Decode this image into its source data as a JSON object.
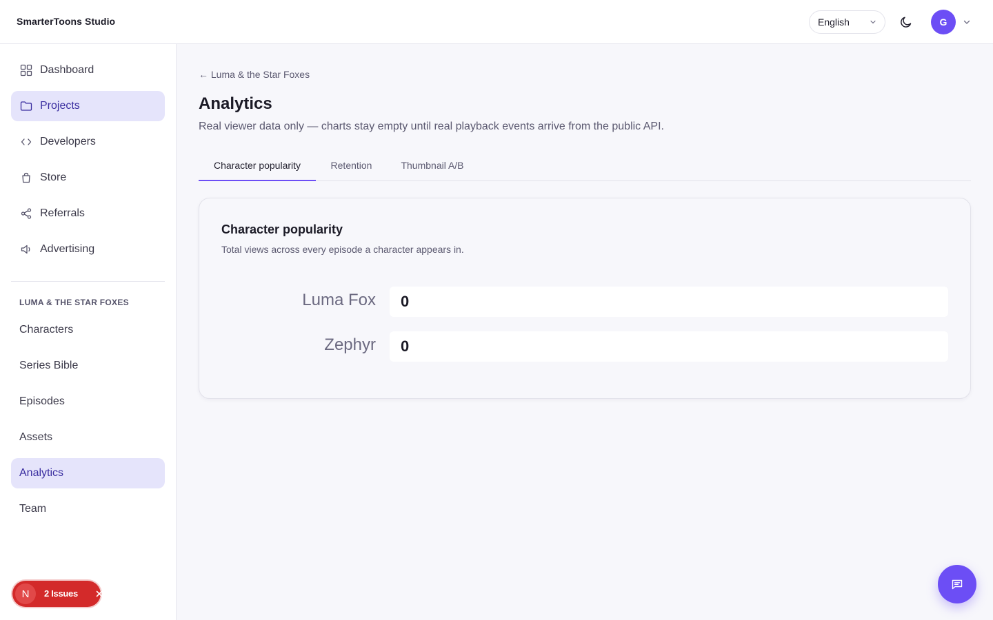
{
  "app": {
    "brand": "SmarterToons Studio"
  },
  "header": {
    "language": "English",
    "avatar_initial": "G"
  },
  "sidebar": {
    "main_items": [
      {
        "label": "Dashboard",
        "icon": "grid-icon"
      },
      {
        "label": "Projects",
        "icon": "folder-icon",
        "active": true
      },
      {
        "label": "Developers",
        "icon": "code-icon"
      },
      {
        "label": "Store",
        "icon": "bag-icon"
      },
      {
        "label": "Referrals",
        "icon": "share-icon"
      },
      {
        "label": "Advertising",
        "icon": "megaphone-icon"
      }
    ],
    "section_label": "LUMA & THE STAR FOXES",
    "project_items": [
      {
        "label": "Characters"
      },
      {
        "label": "Series Bible"
      },
      {
        "label": "Episodes"
      },
      {
        "label": "Assets"
      },
      {
        "label": "Analytics",
        "active": true
      },
      {
        "label": "Team"
      }
    ]
  },
  "main": {
    "back_link": "← Luma & the Star Foxes",
    "title": "Analytics",
    "subtitle": "Real viewer data only — charts stay empty until real playback events arrive from the public API.",
    "tabs": [
      {
        "label": "Character popularity",
        "active": true
      },
      {
        "label": "Retention"
      },
      {
        "label": "Thumbnail A/B"
      }
    ],
    "card": {
      "title": "Character popularity",
      "subtitle": "Total views across every episode a character appears in."
    }
  },
  "chart_data": {
    "type": "bar",
    "orientation": "horizontal",
    "categories": [
      "Luma Fox",
      "Zephyr"
    ],
    "values": [
      0,
      0
    ],
    "value_labels": [
      "0",
      "0"
    ],
    "title": "Character popularity"
  },
  "issues_badge": {
    "initial": "N",
    "text": "2 Issues"
  },
  "colors": {
    "accent": "#6c4ef5",
    "active_nav_bg": "#e5e4fb",
    "issues_red": "#d32a2a"
  }
}
